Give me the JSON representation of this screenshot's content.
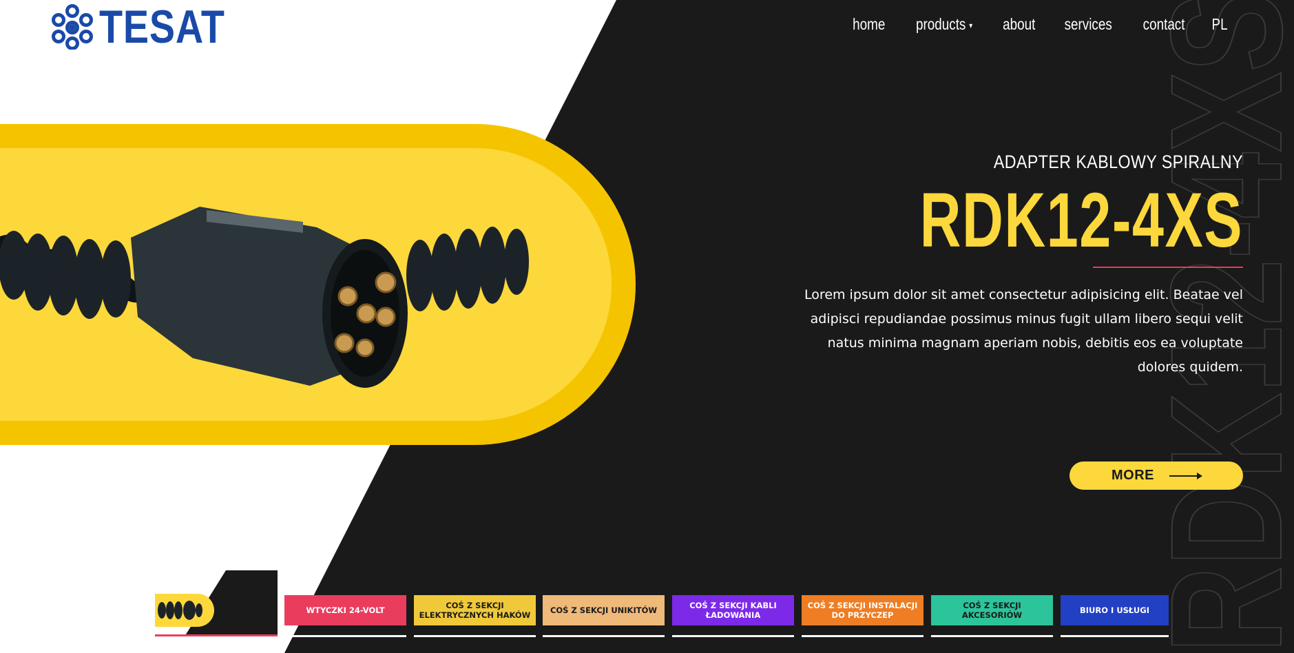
{
  "brand": {
    "name": "TESAT"
  },
  "nav": {
    "items": [
      {
        "label": "home"
      },
      {
        "label": "products",
        "has_dropdown": true
      },
      {
        "label": "about"
      },
      {
        "label": "services"
      },
      {
        "label": "contact"
      },
      {
        "label": "PL"
      }
    ]
  },
  "hero": {
    "subtitle": "ADAPTER KABLOWY SPIRALNY",
    "title": "RDK12-4XS",
    "background_watermark": "RDK12-4XS",
    "description": "Lorem ipsum dolor sit amet consectetur adipisicing elit. Beatae vel adipisci repudiandae possimus minus fugit ullam libero sequi velit natus minima magnam aperiam nobis, debitis eos ea voluptate dolores quidem.",
    "more_label": "MORE"
  },
  "tabs": [
    {
      "label": "WTYCZKI 24-VOLT",
      "color": "#ea3d5e",
      "text_color": "#ffffff"
    },
    {
      "label": "COŚ Z SEKCJI ELEKTRYCZNYCH HAKÓW",
      "color": "#f0c93a",
      "text_color": "#1a1a1a"
    },
    {
      "label": "COŚ Z SEKCJI UNIKITÓW",
      "color": "#efb97a",
      "text_color": "#1a1a1a"
    },
    {
      "label": "COŚ Z SEKCJI KABLI ŁADOWANIA",
      "color": "#7c2ae8",
      "text_color": "#ffffff"
    },
    {
      "label": "COŚ Z SEKCJI INSTALACJI DO PRZYCZEP",
      "color": "#ee7d23",
      "text_color": "#ffffff"
    },
    {
      "label": "COŚ Z SEKCJI AKCESORIÓW",
      "color": "#2cc49a",
      "text_color": "#1a1a1a"
    },
    {
      "label": "BIURO I USŁUGI",
      "color": "#2240c4",
      "text_color": "#ffffff"
    }
  ],
  "colors": {
    "dark_bg": "#1a1a1a",
    "accent_yellow": "#fcd83c",
    "brand_blue": "#1a4aa8",
    "accent_red": "#e9395a"
  }
}
